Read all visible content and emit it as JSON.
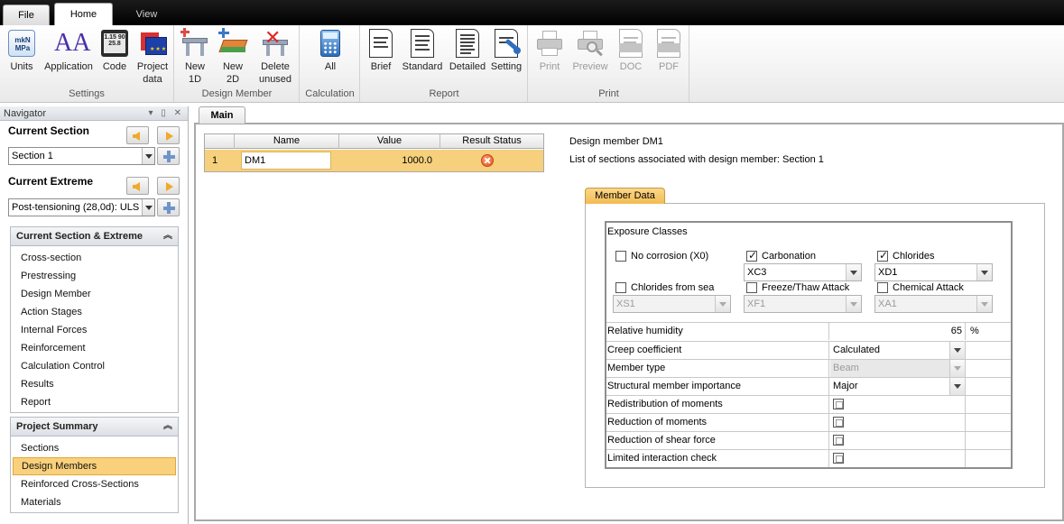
{
  "ribbon": {
    "tabs": [
      {
        "label": "File"
      },
      {
        "label": "Home"
      },
      {
        "label": "View"
      }
    ],
    "groups": {
      "settings": {
        "label": "Settings",
        "buttons": {
          "units": "Units",
          "units_icon_text": "mkN MPa",
          "application": "Application",
          "application_icon_text": "AA",
          "code": "Code",
          "code_icon_text": "1.15 90 25.8",
          "project_data_1": "Project",
          "project_data_2": "data"
        }
      },
      "design_member": {
        "label": "Design Member",
        "buttons": {
          "new1d_1": "New",
          "new1d_2": "1D",
          "new2d_1": "New",
          "new2d_2": "2D",
          "delete_1": "Delete",
          "delete_2": "unused"
        }
      },
      "calculation": {
        "label": "Calculation",
        "buttons": {
          "all": "All"
        }
      },
      "report": {
        "label": "Report",
        "buttons": {
          "brief": "Brief",
          "standard": "Standard",
          "detailed": "Detailed",
          "setting": "Setting"
        }
      },
      "print": {
        "label": "Print",
        "buttons": {
          "print": "Print",
          "preview": "Preview",
          "doc": "DOC",
          "pdf": "PDF"
        }
      }
    }
  },
  "navigator": {
    "title": "Navigator",
    "current_section": {
      "label": "Current Section",
      "value": "Section 1"
    },
    "current_extreme": {
      "label": "Current Extreme",
      "value": "Post-tensioning (28,0d): ULS"
    },
    "panel1": {
      "title": "Current Section & Extreme",
      "items": [
        "Cross-section",
        "Prestressing",
        "Design Member",
        "Action Stages",
        "Internal Forces",
        "Reinforcement",
        "Calculation Control",
        "Results",
        "Report"
      ]
    },
    "panel2": {
      "title": "Project Summary",
      "items": [
        "Sections",
        "Design Members",
        "Reinforced Cross-Sections",
        "Materials"
      ],
      "selected": "Design Members"
    }
  },
  "main": {
    "tab": "Main",
    "grid": {
      "columns": [
        "Name",
        "Value",
        "Result Status"
      ],
      "rows": [
        {
          "index": "1",
          "name": "DM1",
          "value": "1000.0",
          "status": "error"
        }
      ]
    },
    "design_member_label": "Design member  DM1",
    "sections_label": "List of sections associated with design member:  Section 1"
  },
  "member_data": {
    "tab": "Member Data",
    "exposure": {
      "title": "Exposure Classes",
      "no_corrosion": {
        "label": "No corrosion (X0)",
        "checked": false
      },
      "carbonation": {
        "label": "Carbonation",
        "checked": true,
        "value": "XC3"
      },
      "chlorides": {
        "label": "Chlorides",
        "checked": true,
        "value": "XD1"
      },
      "chlorides_sea": {
        "label": "Chlorides from sea",
        "checked": false,
        "value": "XS1"
      },
      "freeze_thaw": {
        "label": "Freeze/Thaw Attack",
        "checked": false,
        "value": "XF1"
      },
      "chemical": {
        "label": "Chemical Attack",
        "checked": false,
        "value": "XA1"
      }
    },
    "properties": {
      "relative_humidity": {
        "label": "Relative humidity",
        "value": "65",
        "unit": "%"
      },
      "creep_coefficient": {
        "label": "Creep coefficient",
        "value": "Calculated"
      },
      "member_type": {
        "label": "Member type",
        "value": "Beam"
      },
      "importance": {
        "label": "Structural member importance",
        "value": "Major"
      },
      "redistribution": {
        "label": "Redistribution of moments"
      },
      "reduction_moments": {
        "label": "Reduction of moments"
      },
      "reduction_shear": {
        "label": "Reduction of shear force"
      },
      "limited_interaction": {
        "label": "Limited interaction check"
      }
    }
  },
  "colors": {
    "selection": "#f9d17d",
    "accent_orange": "#f0a92a",
    "error": "#e2541f"
  }
}
